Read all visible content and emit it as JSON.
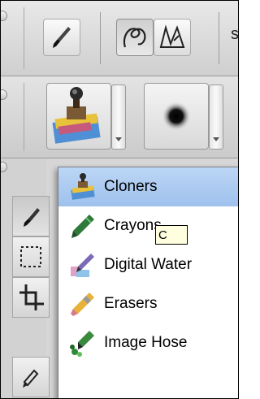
{
  "property_bar": {
    "tools": [
      {
        "icon": "brush-icon",
        "pressed": false
      },
      {
        "icon": "freehand-stroke-icon",
        "pressed": true
      },
      {
        "icon": "straight-line-stroke-icon",
        "pressed": false
      }
    ],
    "trailing_text": "s"
  },
  "brush_selector": {
    "category_icon": "cloners-stamp-icon",
    "variant_icon": "soft-dab-icon"
  },
  "brush_menu": {
    "items": [
      {
        "label": "Cloners",
        "icon": "cloners-stamp-icon",
        "selected": true
      },
      {
        "label": "Crayons",
        "icon": "crayon-icon",
        "selected": false
      },
      {
        "label": "Digital Water",
        "icon": "digital-watercolor-icon",
        "selected": false
      },
      {
        "label": "Erasers",
        "icon": "eraser-icon",
        "selected": false
      },
      {
        "label": "Image Hose",
        "icon": "image-hose-icon",
        "selected": false
      }
    ],
    "tooltip": "C"
  },
  "toolbox": {
    "tools": [
      "brush-tool-icon",
      "marquee-tool-icon",
      "crop-tool-icon",
      "pen-tool-icon"
    ]
  },
  "colors": {
    "selection": "#a9c9f1",
    "menu_background": "#ffffff",
    "tooltip_background": "#ffffe0"
  }
}
